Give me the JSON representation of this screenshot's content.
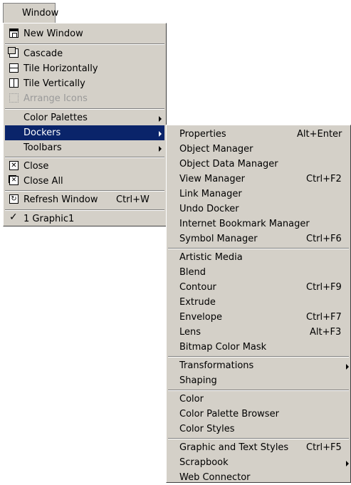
{
  "menubar": {
    "window_label": "Window"
  },
  "window_menu": {
    "items": [
      {
        "label": "New Window",
        "icon": "new-window-icon"
      },
      {
        "label": "Cascade",
        "icon": "cascade-icon"
      },
      {
        "label": "Tile Horizontally",
        "icon": "tile-horizontally-icon"
      },
      {
        "label": "Tile Vertically",
        "icon": "tile-vertically-icon"
      },
      {
        "label": "Arrange Icons",
        "icon": "arrange-icons-icon",
        "disabled": true
      },
      {
        "label": "Color Palettes",
        "submenu": true
      },
      {
        "label": "Dockers",
        "submenu": true,
        "selected": true
      },
      {
        "label": "Toolbars",
        "submenu": true
      },
      {
        "label": "Close",
        "icon": "close-icon"
      },
      {
        "label": "Close All",
        "icon": "close-all-icon"
      },
      {
        "label": "Refresh Window",
        "shortcut": "Ctrl+W",
        "icon": "refresh-icon"
      },
      {
        "label": "1 Graphic1",
        "checked": true,
        "icon": "checkmark-icon"
      }
    ]
  },
  "dockers_menu": {
    "items": [
      {
        "label": "Properties",
        "shortcut": "Alt+Enter"
      },
      {
        "label": "Object Manager"
      },
      {
        "label": "Object Data Manager"
      },
      {
        "label": "View Manager",
        "shortcut": "Ctrl+F2"
      },
      {
        "label": "Link Manager"
      },
      {
        "label": "Undo Docker"
      },
      {
        "label": "Internet Bookmark Manager"
      },
      {
        "label": "Symbol Manager",
        "shortcut": "Ctrl+F6"
      },
      {
        "label": "Artistic Media"
      },
      {
        "label": "Blend"
      },
      {
        "label": "Contour",
        "shortcut": "Ctrl+F9"
      },
      {
        "label": "Extrude"
      },
      {
        "label": "Envelope",
        "shortcut": "Ctrl+F7"
      },
      {
        "label": "Lens",
        "shortcut": "Alt+F3"
      },
      {
        "label": "Bitmap Color Mask"
      },
      {
        "label": "Transformations",
        "submenu": true
      },
      {
        "label": "Shaping"
      },
      {
        "label": "Color"
      },
      {
        "label": "Color Palette Browser"
      },
      {
        "label": "Color Styles"
      },
      {
        "label": "Graphic and Text Styles",
        "shortcut": "Ctrl+F5"
      },
      {
        "label": "Scrapbook",
        "submenu": true
      },
      {
        "label": "Web Connector"
      }
    ]
  },
  "colors": {
    "menu_bg": "#d4d0c8",
    "highlight": "#0a246a",
    "disabled_text": "#9a9a9a"
  }
}
